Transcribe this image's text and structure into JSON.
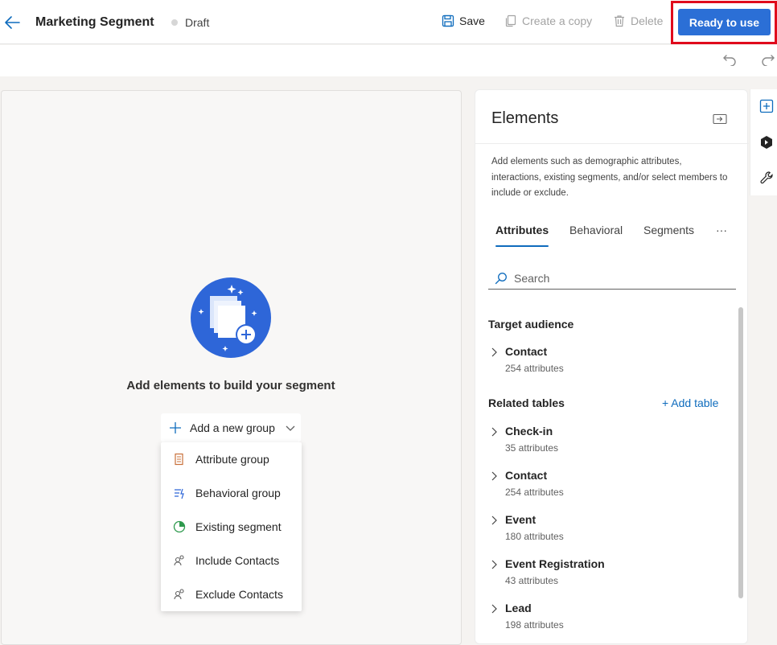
{
  "header": {
    "title": "Marketing Segment",
    "status": "Draft",
    "save_label": "Save",
    "copy_label": "Create a copy",
    "delete_label": "Delete",
    "ready_label": "Ready to use"
  },
  "canvas": {
    "empty_text": "Add elements to build your segment",
    "add_group_label": "Add a new group",
    "menu": [
      {
        "label": "Attribute group",
        "icon": "attribute-group-icon"
      },
      {
        "label": "Behavioral group",
        "icon": "behavioral-group-icon"
      },
      {
        "label": "Existing segment",
        "icon": "existing-segment-icon"
      },
      {
        "label": "Include Contacts",
        "icon": "include-contacts-icon"
      },
      {
        "label": "Exclude Contacts",
        "icon": "exclude-contacts-icon"
      }
    ]
  },
  "panel": {
    "title": "Elements",
    "description": "Add elements such as demographic attributes, interactions, existing segments, and/or select members to include or exclude.",
    "tabs": [
      "Attributes",
      "Behavioral",
      "Segments",
      "···"
    ],
    "search_placeholder": "Search",
    "target_audience_label": "Target audience",
    "related_tables_label": "Related tables",
    "add_table_label": "+ Add table",
    "target_items": [
      {
        "name": "Contact",
        "count": "254 attributes"
      }
    ],
    "related_items": [
      {
        "name": "Check-in",
        "count": "35 attributes"
      },
      {
        "name": "Contact",
        "count": "254 attributes"
      },
      {
        "name": "Event",
        "count": "180 attributes"
      },
      {
        "name": "Event Registration",
        "count": "43 attributes"
      },
      {
        "name": "Lead",
        "count": "198 attributes"
      }
    ]
  },
  "colors": {
    "accent": "#0f6cbd",
    "primary_button": "#2b6fd6",
    "highlight_frame": "#e00b1c"
  }
}
